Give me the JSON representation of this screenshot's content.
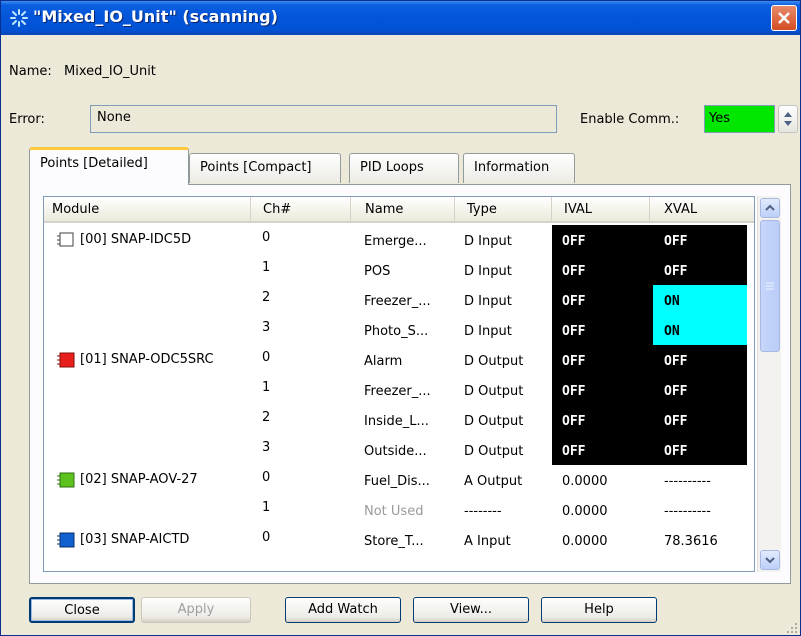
{
  "window": {
    "title": "\"Mixed_IO_Unit\" (scanning)"
  },
  "name_label": "Name:",
  "name_value": "Mixed_IO_Unit",
  "error_label": "Error:",
  "error_value": "None",
  "enable_comm_label": "Enable Comm.:",
  "enable_comm_value": "Yes",
  "tabs": [
    {
      "label": "Points [Detailed]",
      "active": true
    },
    {
      "label": "Points [Compact]"
    },
    {
      "label": "PID Loops"
    },
    {
      "label": "Information"
    }
  ],
  "columns": [
    "Module",
    "Ch#",
    "Name",
    "Type",
    "IVAL",
    "XVAL"
  ],
  "modules": [
    {
      "label": "[00] SNAP-IDC5D",
      "icon": "white-module-icon",
      "color": "#ffffff"
    },
    {
      "label": "[01] SNAP-ODC5SRC",
      "icon": "red-module-icon",
      "color": "#e8201c"
    },
    {
      "label": "[02] SNAP-AOV-27",
      "icon": "green-module-icon",
      "color": "#5ec21e"
    },
    {
      "label": "[03] SNAP-AICTD",
      "icon": "blue-module-icon",
      "color": "#1060d0"
    }
  ],
  "rows": [
    {
      "ch": "0",
      "name": "Emerge...",
      "type": "D Input",
      "ival": "OFF",
      "xval": "OFF"
    },
    {
      "ch": "1",
      "name": "POS",
      "type": "D Input",
      "ival": "OFF",
      "xval": "OFF"
    },
    {
      "ch": "2",
      "name": "Freezer_...",
      "type": "D Input",
      "ival": "OFF",
      "xval": "ON"
    },
    {
      "ch": "3",
      "name": "Photo_S...",
      "type": "D Input",
      "ival": "OFF",
      "xval": "ON"
    },
    {
      "ch": "0",
      "name": "Alarm",
      "type": "D Output",
      "ival": "OFF",
      "xval": "OFF"
    },
    {
      "ch": "1",
      "name": "Freezer_...",
      "type": "D Output",
      "ival": "OFF",
      "xval": "OFF"
    },
    {
      "ch": "2",
      "name": "Inside_L...",
      "type": "D Output",
      "ival": "OFF",
      "xval": "OFF"
    },
    {
      "ch": "3",
      "name": "Outside...",
      "type": "D Output",
      "ival": "OFF",
      "xval": "OFF"
    },
    {
      "ch": "0",
      "name": "Fuel_Dis...",
      "type": "A Output",
      "ival": "0.0000",
      "xval": "----------"
    },
    {
      "ch": "1",
      "name": "Not Used",
      "type": "--------",
      "ival": "0.0000",
      "xval": "----------"
    },
    {
      "ch": "0",
      "name": "Store_T...",
      "type": "A Input",
      "ival": "0.0000",
      "xval": "78.3616"
    }
  ],
  "buttons": {
    "close": "Close",
    "apply": "Apply",
    "add_watch": "Add Watch",
    "view": "View...",
    "help": "Help"
  },
  "colors": {
    "title_bar": "#0354d8",
    "enable_comm_bg": "#00e600",
    "state_bg": "#000000",
    "on_bg": "#00ffff",
    "active_tab_accent": "#ffc83c"
  }
}
